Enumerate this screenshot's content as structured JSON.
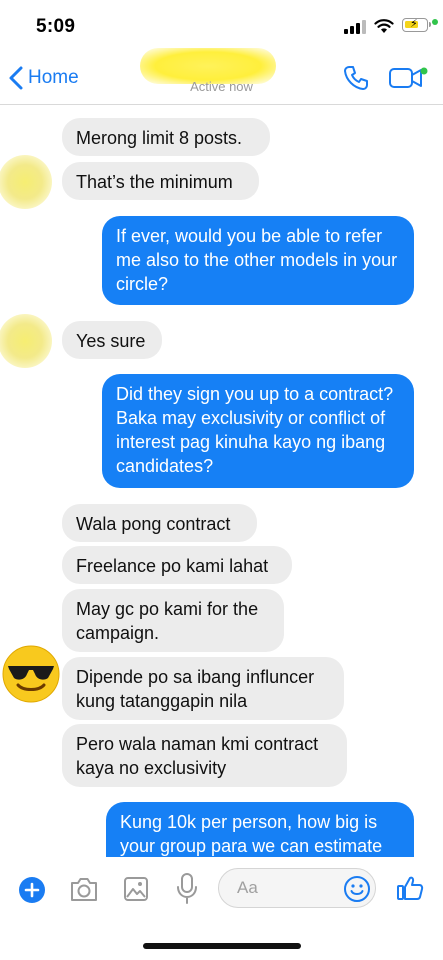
{
  "status_bar": {
    "time": "5:09",
    "icons": [
      "signal-icon",
      "wifi-icon",
      "battery-charging-icon"
    ]
  },
  "header": {
    "back_label": "Home",
    "subtitle": "Active now",
    "icons": [
      "chevron-left-icon",
      "phone-icon",
      "video-camera-icon"
    ]
  },
  "messages": [
    {
      "side": "in",
      "text": "Merong limit 8 posts."
    },
    {
      "side": "in",
      "text": "That’s the minimum"
    },
    {
      "side": "out",
      "text": "If ever, would you be able to refer me also to the other models in your circle?"
    },
    {
      "side": "in",
      "text": "Yes sure"
    },
    {
      "side": "out",
      "text": "Did they sign you up to a contract? Baka may exclusivity or conflict of interest pag kinuha kayo ng ibang candidates?"
    },
    {
      "side": "in",
      "text": "Wala pong contract"
    },
    {
      "side": "in",
      "text": "Freelance po kami lahat"
    },
    {
      "side": "in",
      "text": "May gc po kami for the campaign."
    },
    {
      "side": "in",
      "text": "Dipende po sa ibang influncer kung tatanggapin nila"
    },
    {
      "side": "in",
      "text": "Pero wala naman kmi contract kaya no exclusivity"
    },
    {
      "side": "out",
      "text": "Kung 10k per person, how big is your group para we can estimate"
    }
  ],
  "composer": {
    "placeholder": "Aa",
    "icons": [
      "plus-icon",
      "camera-icon",
      "image-icon",
      "microphone-icon",
      "emoji-icon",
      "thumbs-up-icon"
    ]
  },
  "colors": {
    "accent": "#1a7cf2",
    "outgoing_bubble": "#1680f5",
    "incoming_bubble": "#ececec"
  }
}
